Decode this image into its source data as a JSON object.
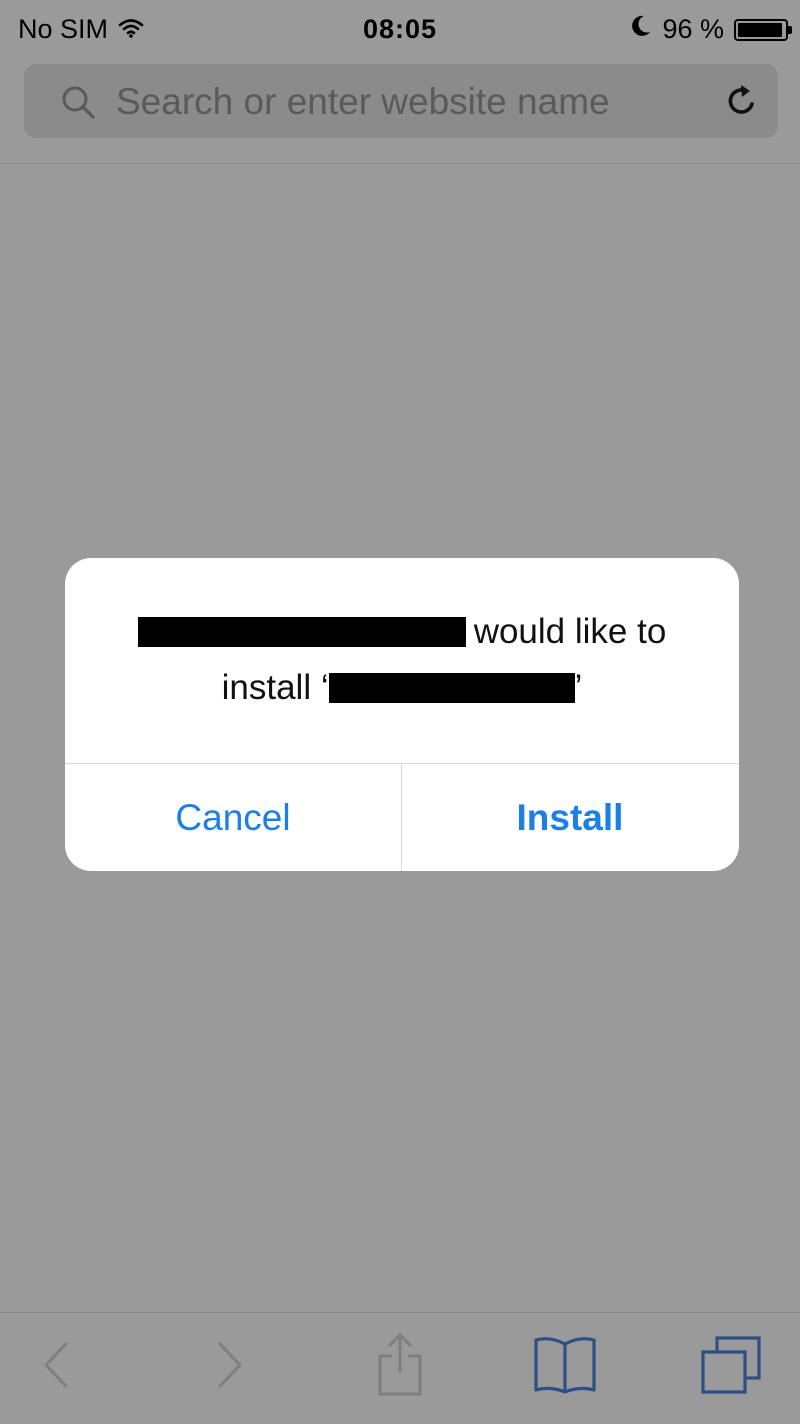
{
  "status_bar": {
    "carrier": "No SIM",
    "time": "08:05",
    "battery_text": "96 %",
    "battery_level": 0.96,
    "icons": [
      "wifi-icon",
      "moon-icon",
      "battery-icon"
    ]
  },
  "url_bar": {
    "placeholder": "Search or enter website name",
    "icons": [
      "search-icon",
      "reload-icon"
    ]
  },
  "alert": {
    "message_part1": "would like to",
    "message_part2_prefix": "install ‘",
    "message_part2_suffix": "’",
    "cancel_label": "Cancel",
    "install_label": "Install"
  },
  "toolbar": {
    "icons": [
      "back-icon",
      "forward-icon",
      "share-icon",
      "bookmarks-icon",
      "tabs-icon"
    ]
  },
  "colors": {
    "overlay_background": "#9a9a9a",
    "alert_background": "#ffffff",
    "button_blue": "#1a7fe6",
    "toolbar_icon_blue": "#2c4f86"
  }
}
